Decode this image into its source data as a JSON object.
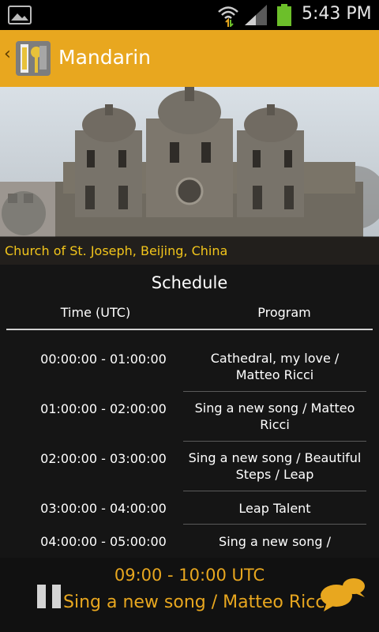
{
  "status_bar": {
    "time": "5:43 PM"
  },
  "action_bar": {
    "title": "Mandarin"
  },
  "hero": {
    "caption": "Church of St. Joseph, Beijing, China"
  },
  "schedule": {
    "title": "Schedule",
    "col_time": "Time (UTC)",
    "col_program": "Program",
    "rows": [
      {
        "time": "00:00:00 - 01:00:00",
        "program_line1": "Cathedral, my love /",
        "program_line2": "Matteo Ricci"
      },
      {
        "time": "01:00:00 - 02:00:00",
        "program_line1": "Sing a new song / Matteo",
        "program_line2": "Ricci"
      },
      {
        "time": "02:00:00 - 03:00:00",
        "program_line1": "Sing a new song / Beautiful",
        "program_line2": "Steps / Leap"
      },
      {
        "time": "03:00:00 - 04:00:00",
        "program_line1": "Leap Talent",
        "program_line2": ""
      },
      {
        "time": "04:00:00 - 05:00:00",
        "program_line1": "Sing a new song /",
        "program_line2": ""
      }
    ]
  },
  "player": {
    "time_range": "09:00 - 10:00 UTC",
    "program": "Sing a new song / Matteo Ricci"
  },
  "colors": {
    "accent": "#e8a71f",
    "caption": "#f2c51b",
    "background": "#151515"
  }
}
